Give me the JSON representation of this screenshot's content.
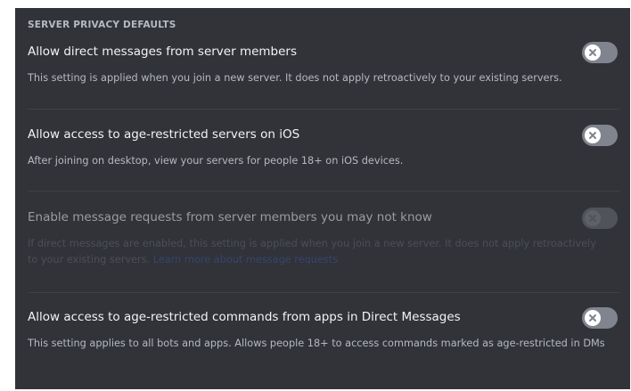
{
  "section": {
    "title": "SERVER PRIVACY DEFAULTS"
  },
  "settings": [
    {
      "title": "Allow direct messages from server members",
      "description": "This setting is applied when you join a new server. It does not apply retroactively to your existing servers.",
      "enabled": false,
      "disabled": false
    },
    {
      "title": "Allow access to age-restricted servers on iOS",
      "description": "After joining on desktop, view your servers for people 18+ on iOS devices.",
      "enabled": false,
      "disabled": false
    },
    {
      "title": "Enable message requests from server members you may not know",
      "description": "If direct messages are enabled, this setting is applied when you join a new server. It does not apply retroactively to your existing servers.",
      "link_text": "Learn more about message requests",
      "enabled": false,
      "disabled": true
    },
    {
      "title": "Allow access to age-restricted commands from apps in Direct Messages",
      "description": "This setting applies to all bots and apps. Allows people 18+ to access commands marked as age-restricted in DMs",
      "enabled": false,
      "disabled": false
    }
  ],
  "colors": {
    "background": "#313338",
    "toggle_off": "#80848e",
    "toggle_disabled": "#50535a",
    "title_text": "#f2f3f5",
    "description_text": "#b5bac1"
  }
}
